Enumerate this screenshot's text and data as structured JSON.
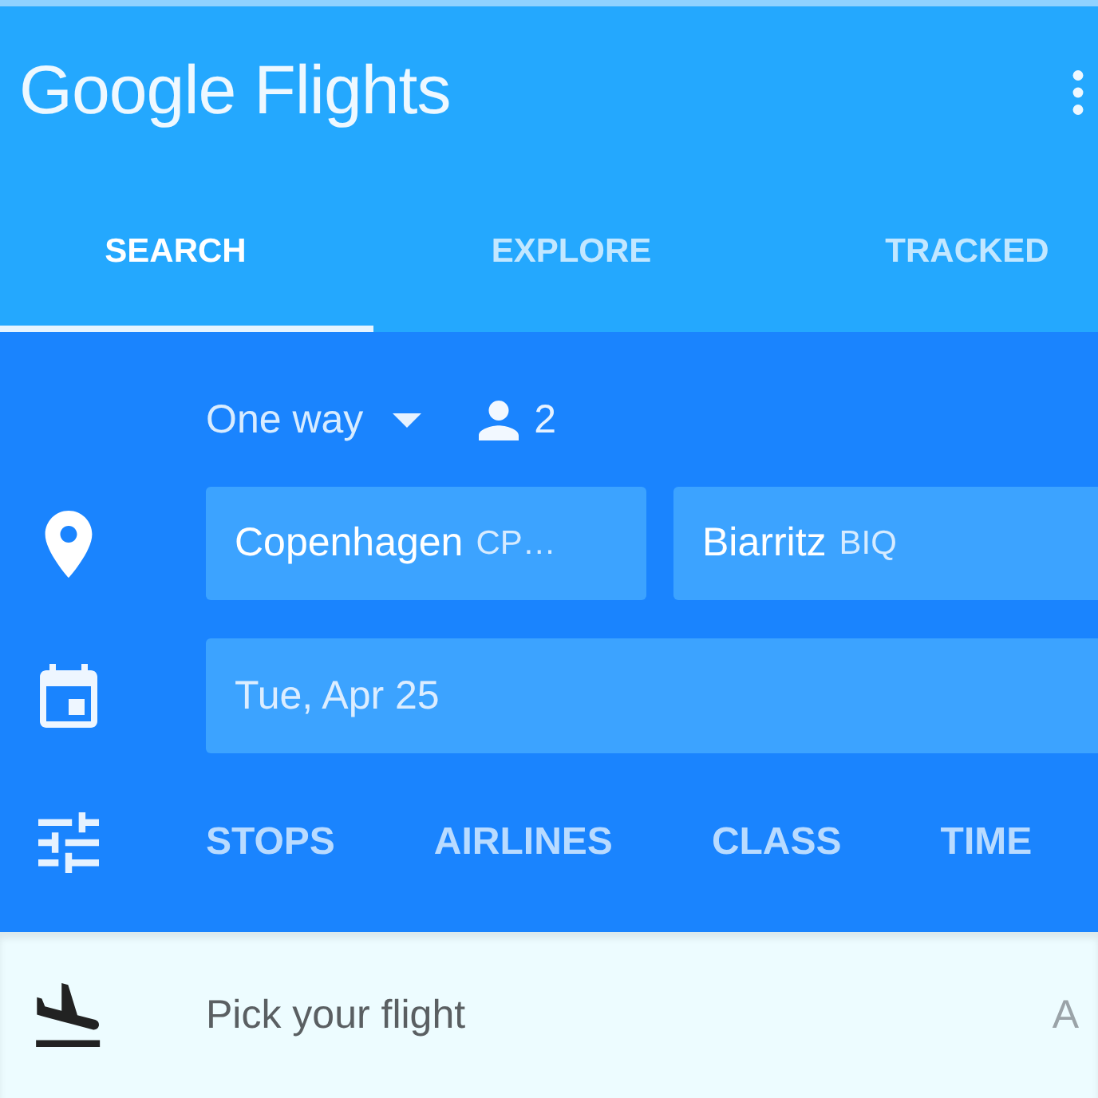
{
  "app_bar": {
    "title": "Google Flights"
  },
  "tabs": [
    {
      "label": "SEARCH",
      "selected": true
    },
    {
      "label": "EXPLORE",
      "selected": false
    },
    {
      "label": "TRACKED",
      "selected": false
    }
  ],
  "search": {
    "trip_type": "One way",
    "passengers": "2",
    "origin": {
      "city": "Copenhagen",
      "code": "CP…"
    },
    "destination": {
      "city": "Biarritz",
      "code": "BIQ"
    },
    "date": "Tue, Apr 25"
  },
  "filters": [
    "STOPS",
    "AIRLINES",
    "CLASS",
    "TIME"
  ],
  "results": {
    "heading": "Pick your flight",
    "column_2": "A"
  }
}
